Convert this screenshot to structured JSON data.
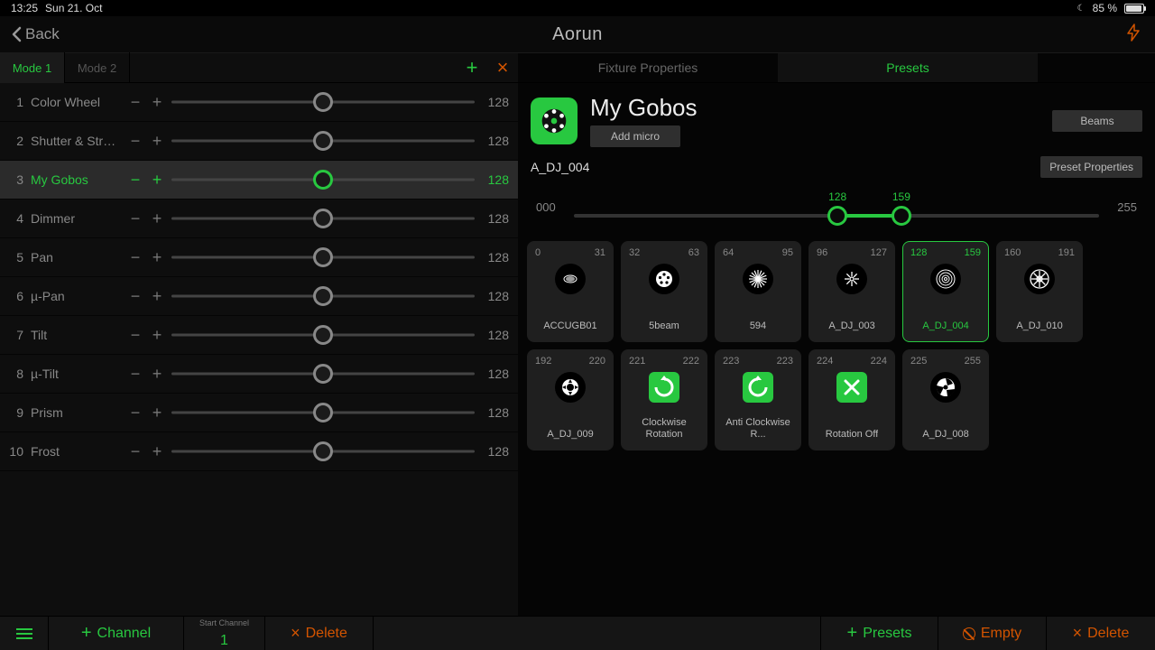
{
  "status": {
    "time": "13:25",
    "date": "Sun 21. Oct",
    "battery": "85 %"
  },
  "nav": {
    "back": "Back",
    "title": "Aorun"
  },
  "modes": {
    "tab1": "Mode 1",
    "tab2": "Mode 2"
  },
  "channels": [
    {
      "n": "1",
      "name": "Color Wheel",
      "val": "128"
    },
    {
      "n": "2",
      "name": "Shutter & Strobe",
      "val": "128"
    },
    {
      "n": "3",
      "name": "My Gobos",
      "val": "128"
    },
    {
      "n": "4",
      "name": "Dimmer",
      "val": "128"
    },
    {
      "n": "5",
      "name": "Pan",
      "val": "128"
    },
    {
      "n": "6",
      "name": "µ-Pan",
      "val": "128"
    },
    {
      "n": "7",
      "name": "Tilt",
      "val": "128"
    },
    {
      "n": "8",
      "name": "µ-Tilt",
      "val": "128"
    },
    {
      "n": "9",
      "name": "Prism",
      "val": "128"
    },
    {
      "n": "10",
      "name": "Frost",
      "val": "128"
    }
  ],
  "selected_channel_index": 2,
  "right_tabs": {
    "fixture": "Fixture Properties",
    "presets": "Presets"
  },
  "preset_header": {
    "title": "My Gobos",
    "add_micro": "Add micro",
    "beams": "Beams",
    "preset_props": "Preset Properties"
  },
  "selected_preset": {
    "name": "A_DJ_004"
  },
  "range": {
    "min": "000",
    "max": "255",
    "lo": "128",
    "hi": "159"
  },
  "presets": [
    {
      "lo": "0",
      "hi": "31",
      "label": "ACCUGB01",
      "kind": "dot"
    },
    {
      "lo": "32",
      "hi": "63",
      "label": "5beam",
      "kind": "dots"
    },
    {
      "lo": "64",
      "hi": "95",
      "label": "594",
      "kind": "burst"
    },
    {
      "lo": "96",
      "hi": "127",
      "label": "A_DJ_003",
      "kind": "star"
    },
    {
      "lo": "128",
      "hi": "159",
      "label": "A_DJ_004",
      "kind": "spiral",
      "selected": true
    },
    {
      "lo": "160",
      "hi": "191",
      "label": "A_DJ_010",
      "kind": "flake"
    },
    {
      "lo": "192",
      "hi": "220",
      "label": "A_DJ_009",
      "kind": "ring"
    },
    {
      "lo": "221",
      "hi": "222",
      "label": "Clockwise Rotation",
      "kind": "green-cw"
    },
    {
      "lo": "223",
      "hi": "223",
      "label": "Anti Clockwise R...",
      "kind": "green-ccw"
    },
    {
      "lo": "224",
      "hi": "224",
      "label": "Rotation Off",
      "kind": "green-x"
    },
    {
      "lo": "225",
      "hi": "255",
      "label": "A_DJ_008",
      "kind": "tri"
    }
  ],
  "bottom": {
    "channel": "Channel",
    "start_channel_label": "Start Channel",
    "start_channel_val": "1",
    "delete": "Delete",
    "presets": "Presets",
    "empty": "Empty",
    "delete2": "Delete"
  }
}
